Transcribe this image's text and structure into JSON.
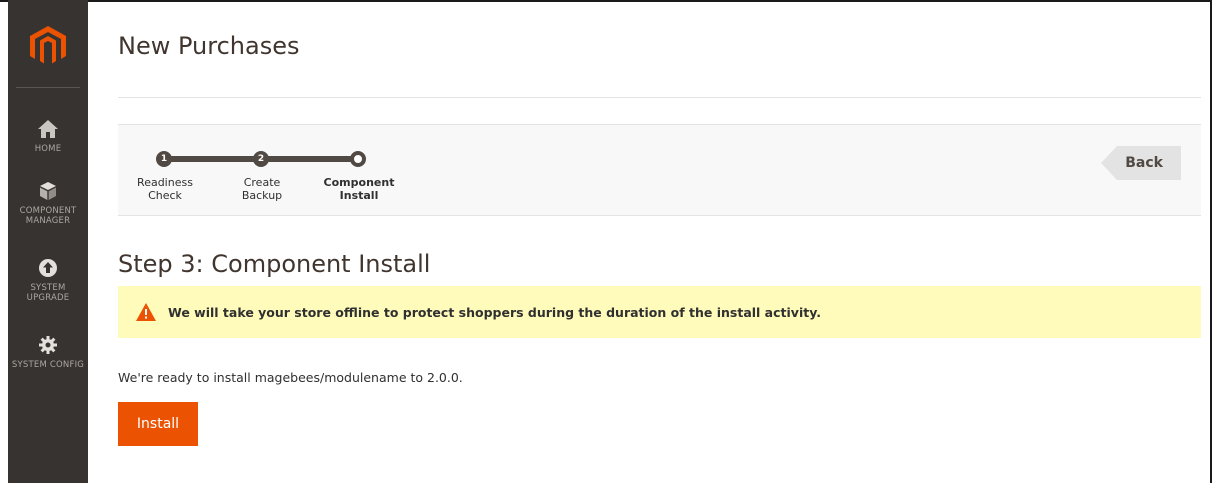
{
  "sidebar": {
    "items": [
      {
        "label": "HOME",
        "icon": "home-icon"
      },
      {
        "label": "COMPONENT MANAGER",
        "icon": "cube-icon"
      },
      {
        "label": "SYSTEM UPGRADE",
        "icon": "upgrade-icon"
      },
      {
        "label": "SYSTEM CONFIG",
        "icon": "gear-icon"
      }
    ]
  },
  "header": {
    "title": "New Purchases"
  },
  "progress": {
    "steps": [
      {
        "number": "1",
        "label": "Readiness\nCheck",
        "state": "done"
      },
      {
        "number": "2",
        "label": "Create\nBackup",
        "state": "done"
      },
      {
        "number": "",
        "label": "Component\nInstall",
        "state": "current"
      }
    ],
    "back_label": "Back"
  },
  "content": {
    "heading": "Step 3: Component Install",
    "warning": "We will take your store offline to protect shoppers during the duration of the install activity.",
    "ready_text": "We're ready to install magebees/modulename to 2.0.0.",
    "install_label": "Install"
  },
  "colors": {
    "sidebar": "#373330",
    "accent": "#eb5202",
    "warning_bg": "#fffbbb",
    "step_dark": "#514943"
  }
}
